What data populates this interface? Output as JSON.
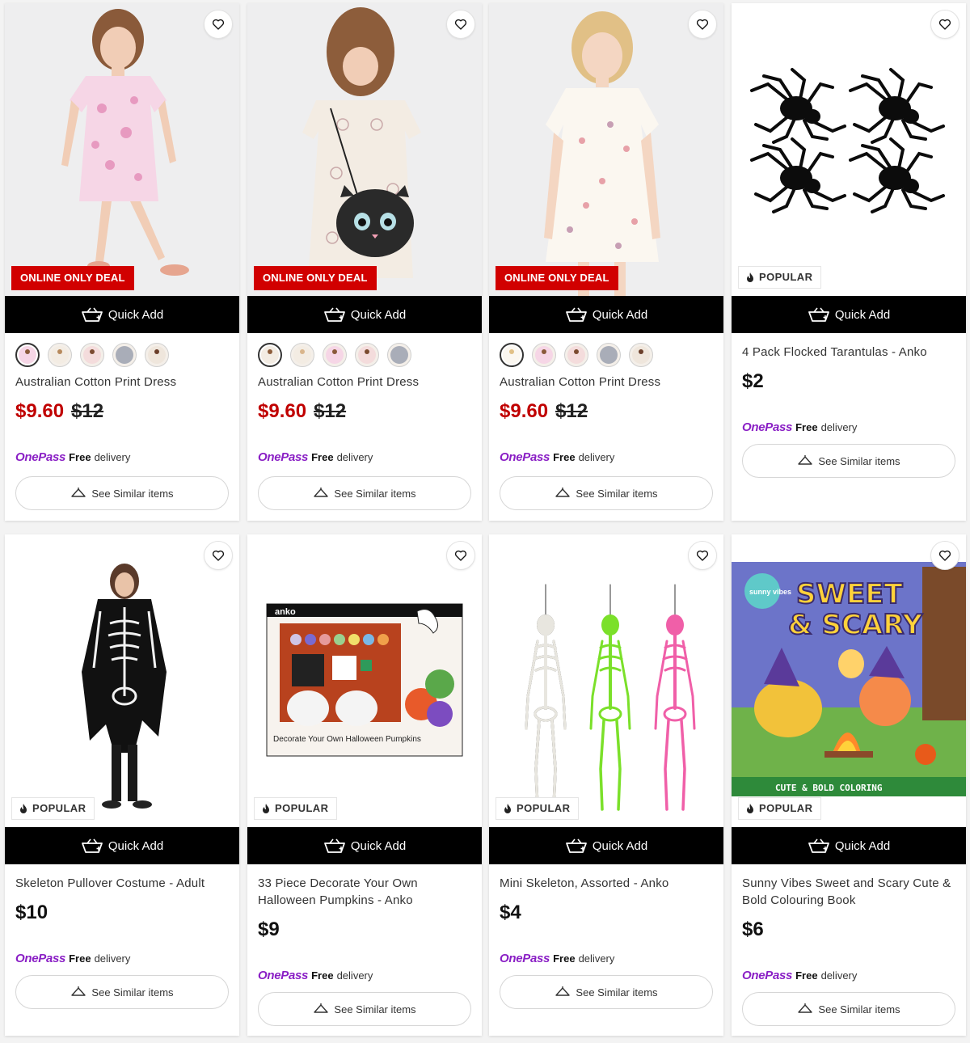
{
  "labels": {
    "quick_add": "Quick Add",
    "see_similar": "See Similar items",
    "online_only_deal": "ONLINE ONLY DEAL",
    "popular": "POPULAR",
    "onepass_logo": "OnePass",
    "onepass_free": "Free",
    "onepass_delivery": "delivery"
  },
  "colors": {
    "deal_badge": "#d10000",
    "sale_price": "#c00000",
    "onepass_purple": "#8a1fc5",
    "quick_add_bg": "#000000"
  },
  "products": [
    {
      "title": "Australian Cotton Print Dress",
      "price": "$9.60",
      "was_price": "$12",
      "badge": "ONLINE ONLY DEAL",
      "image": "girl-pink-floral-dress",
      "swatch_count": 5
    },
    {
      "title": "Australian Cotton Print Dress",
      "price": "$9.60",
      "was_price": "$12",
      "badge": "ONLINE ONLY DEAL",
      "image": "girl-cat-print-dress-with-cat-bag",
      "swatch_count": 5
    },
    {
      "title": "Australian Cotton Print Dress",
      "price": "$9.60",
      "was_price": "$12",
      "badge": "ONLINE ONLY DEAL",
      "image": "girl-palm-print-dress",
      "swatch_count": 5
    },
    {
      "title": "4 Pack Flocked Tarantulas - Anko",
      "price": "$2",
      "badge": "POPULAR",
      "image": "four-black-spiders"
    },
    {
      "title": "Skeleton Pullover Costume - Adult",
      "price": "$10",
      "badge": "POPULAR",
      "image": "woman-skeleton-costume"
    },
    {
      "title": "33 Piece Decorate Your Own Halloween Pumpkins - Anko",
      "price": "$9",
      "badge": "POPULAR",
      "image": "pumpkin-paint-kit-box",
      "box_brand": "anko",
      "box_text": "Decorate Your Own Halloween Pumpkins"
    },
    {
      "title": "Mini Skeleton, Assorted - Anko",
      "price": "$4",
      "badge": "POPULAR",
      "image": "three-hanging-skeletons"
    },
    {
      "title": "Sunny Vibes Sweet and Scary Cute & Bold Colouring Book",
      "price": "$6",
      "badge": "POPULAR",
      "image": "colouring-book-cover",
      "cover_title_1": "SWEET",
      "cover_title_2": "& SCARY",
      "cover_sub": "CUTE & BOLD COLORING",
      "cover_brand": "sunny vibes"
    }
  ]
}
